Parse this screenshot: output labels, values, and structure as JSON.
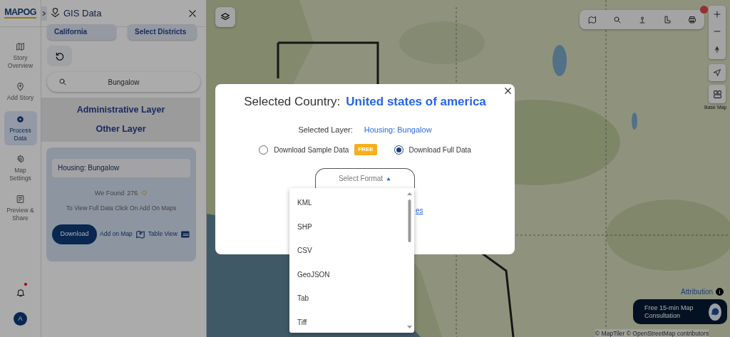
{
  "sidebar": {
    "logo": "MAPOG",
    "nav": [
      {
        "label": "Story Overview",
        "selected": false
      },
      {
        "label": "Add Story",
        "selected": false
      },
      {
        "label": "Process Data",
        "selected": true
      },
      {
        "label": "Map Settings",
        "selected": false
      },
      {
        "label": "Preview & Share",
        "selected": false
      }
    ],
    "notifications": {
      "unread": true
    },
    "avatar": "A"
  },
  "panel": {
    "title": "GIS Data",
    "region_buttons": [
      "California",
      "Select Districts"
    ],
    "search": {
      "value": "Bungalow"
    },
    "layer_groups": [
      "Administrative Layer",
      "Other Layer"
    ],
    "result": {
      "layer": "Housing: Bungalow",
      "found_label": "We Found",
      "count": "276",
      "hint": "To View Full Data Click On Add On Maps",
      "download": "Download",
      "add_on_map": "Add on Map",
      "table_view": "Table View"
    }
  },
  "map": {
    "base_map_label": "Base Map",
    "attribution": "Attribution",
    "consultation": "Free 15-min Map Consultation",
    "credits": "© MapTiler © OpenStreetMap contributors"
  },
  "dialog": {
    "title": "Selected Country:",
    "country": "United states of america",
    "layer_label": "Selected Layer:",
    "layer": "Housing: Bungalow",
    "download_options": [
      {
        "label": "Download Sample Data",
        "badge": "FREE",
        "selected": false
      },
      {
        "label": "Download Full Data",
        "selected": true
      }
    ],
    "format": {
      "label": "Select Format",
      "expanded": true,
      "options": [
        "KML",
        "SHP",
        "CSV",
        "GeoJSON",
        "Tab",
        "Tiff"
      ]
    },
    "link_fragment": "es"
  }
}
